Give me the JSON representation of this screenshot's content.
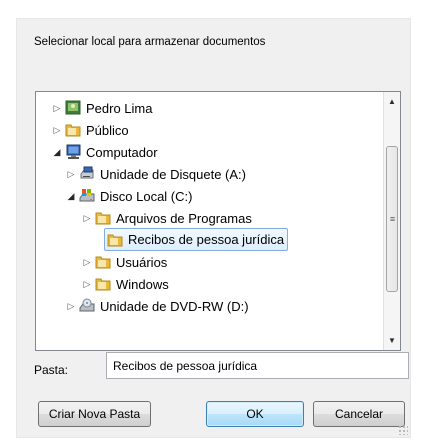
{
  "dialog": {
    "prompt": "Selecionar local para armazenar documentos"
  },
  "tree": {
    "items": [
      {
        "label": "Pedro Lima",
        "icon": "user-folder-icon",
        "expander": "collapsed"
      },
      {
        "label": "Público",
        "icon": "folder-icon",
        "expander": "collapsed"
      },
      {
        "label": "Computador",
        "icon": "computer-icon",
        "expander": "expanded"
      },
      {
        "label": "Unidade de Disquete (A:)",
        "icon": "floppy-drive-icon",
        "expander": "collapsed"
      },
      {
        "label": "Disco Local (C:)",
        "icon": "hard-drive-icon",
        "expander": "expanded"
      },
      {
        "label": "Arquivos de Programas",
        "icon": "folder-icon",
        "expander": "collapsed"
      },
      {
        "label": "Recibos de pessoa jurídica",
        "icon": "folder-icon",
        "expander": "none",
        "selected": true
      },
      {
        "label": "Usuários",
        "icon": "folder-icon",
        "expander": "collapsed"
      },
      {
        "label": "Windows",
        "icon": "folder-icon",
        "expander": "collapsed"
      },
      {
        "label": "Unidade de DVD-RW (D:)",
        "icon": "dvd-drive-icon",
        "expander": "collapsed"
      }
    ]
  },
  "folder_field": {
    "label": "Pasta:",
    "value": "Recibos de pessoa jurídica"
  },
  "buttons": {
    "new_folder": "Criar Nova Pasta",
    "ok": "OK",
    "cancel": "Cancelar"
  },
  "colors": {
    "selection_border": "#84acdd",
    "folder_yellow": "#e9b83a",
    "ok_border": "#3c7fb1"
  }
}
